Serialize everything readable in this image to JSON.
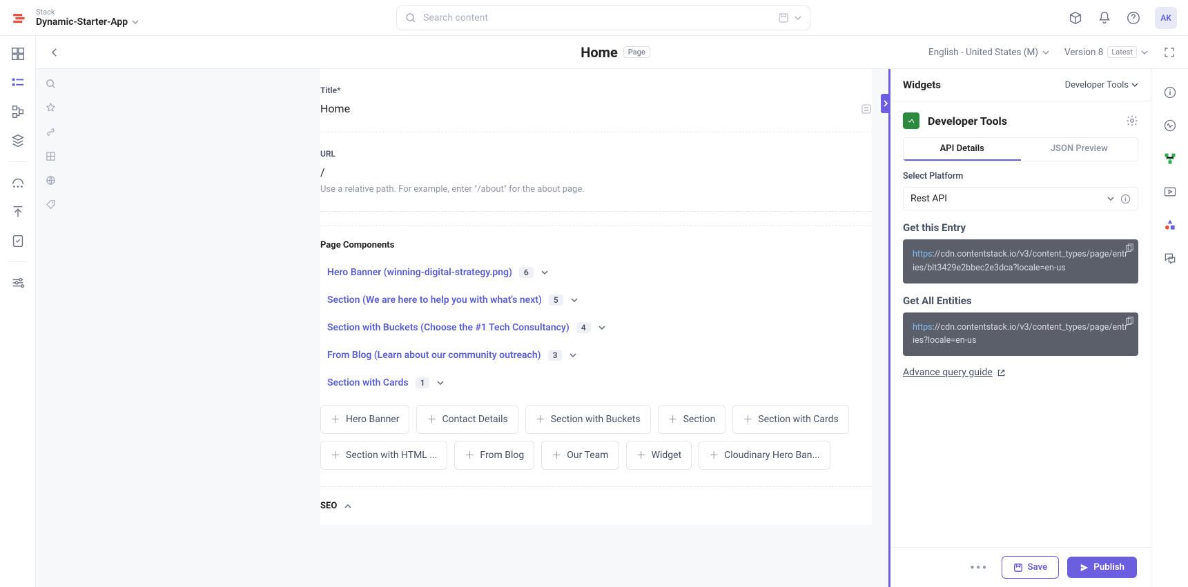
{
  "header": {
    "stack_label": "Stack",
    "stack_name": "Dynamic-Starter-App",
    "search_placeholder": "Search content",
    "avatar_initials": "AK"
  },
  "content_header": {
    "title": "Home",
    "badge": "Page",
    "locale": "English - United States (M)",
    "version_label": "Version 8",
    "version_badge": "Latest"
  },
  "form": {
    "title_label": "Title",
    "title_value": "Home",
    "url_label": "URL",
    "url_value": "/",
    "url_hint": "Use a relative path. For example, enter \"/about\" for the about page.",
    "components_label": "Page Components",
    "seo_label": "SEO"
  },
  "components": [
    {
      "name": "Hero Banner (winning-digital-strategy.png)",
      "count": "6"
    },
    {
      "name": "Section (We are here to help you with what's next)",
      "count": "5"
    },
    {
      "name": "Section with Buckets (Choose the #1 Tech Consultancy)",
      "count": "4"
    },
    {
      "name": "From Blog (Learn about our community outreach)",
      "count": "3"
    },
    {
      "name": "Section with Cards",
      "count": "1"
    }
  ],
  "add_options": [
    "Hero Banner",
    "Contact Details",
    "Section with Buckets",
    "Section",
    "Section with Cards",
    "Section with HTML ...",
    "From Blog",
    "Our Team",
    "Widget",
    "Cloudinary Hero Ban..."
  ],
  "widgets": {
    "panel_title": "Widgets",
    "dropdown": "Developer Tools",
    "card_title": "Developer Tools",
    "tab_api": "API Details",
    "tab_json": "JSON Preview",
    "platform_label": "Select Platform",
    "platform_value": "Rest API",
    "get_entry": "Get this Entry",
    "entry_prefix": "https",
    "entry_url": "://cdn.contentstack.io/v3/content_types/page/entries/blt3429e2bbec2e3dca?locale=en-us",
    "get_all": "Get All Entities",
    "all_prefix": "https",
    "all_url": "://cdn.contentstack.io/v3/content_types/page/entries?locale=en-us",
    "adv_link": "Advance query guide"
  },
  "footer": {
    "save": "Save",
    "publish": "Publish"
  }
}
